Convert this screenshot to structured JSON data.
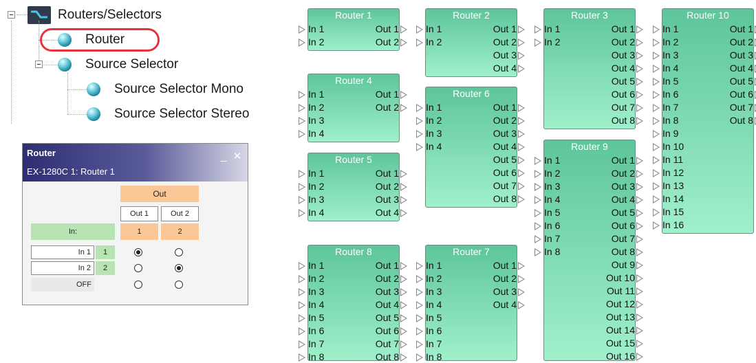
{
  "tree": {
    "root_label": "Routers/Selectors",
    "router_label": "Router",
    "source_selector_label": "Source Selector",
    "mono_label": "Source Selector Mono",
    "stereo_label": "Source Selector Stereo"
  },
  "dialog": {
    "title": "Router",
    "subtitle": "EX-1280C 1: Router 1",
    "minimize": "_",
    "close": "✕",
    "out_header": "Out",
    "out_cols": [
      "Out 1",
      "Out 2"
    ],
    "out_nums": [
      "1",
      "2"
    ],
    "in_header": "In:",
    "rows": [
      {
        "label": "In 1",
        "num": "1",
        "selected": 0
      },
      {
        "label": "In 2",
        "num": "2",
        "selected": 1
      }
    ],
    "off_label": "OFF"
  },
  "routers": [
    {
      "name": "Router 1",
      "inputs": 2,
      "outputs": 2
    },
    {
      "name": "Router 2",
      "inputs": 2,
      "outputs": 4
    },
    {
      "name": "Router 3",
      "inputs": 2,
      "outputs": 8
    },
    {
      "name": "Router 10",
      "inputs": 16,
      "outputs": 8
    },
    {
      "name": "Router 4",
      "inputs": 4,
      "outputs": 2
    },
    {
      "name": "Router 6",
      "inputs": 4,
      "outputs": 8
    },
    {
      "name": "Router 5",
      "inputs": 4,
      "outputs": 4
    },
    {
      "name": "Router 9",
      "inputs": 8,
      "outputs": 16
    },
    {
      "name": "Router 8",
      "inputs": 8,
      "outputs": 8
    },
    {
      "name": "Router 7",
      "inputs": 8,
      "outputs": 4
    }
  ],
  "colors": {
    "block_top": "#5ec59a",
    "block_bottom": "#9ff0cb",
    "highlight": "#e8333d"
  }
}
